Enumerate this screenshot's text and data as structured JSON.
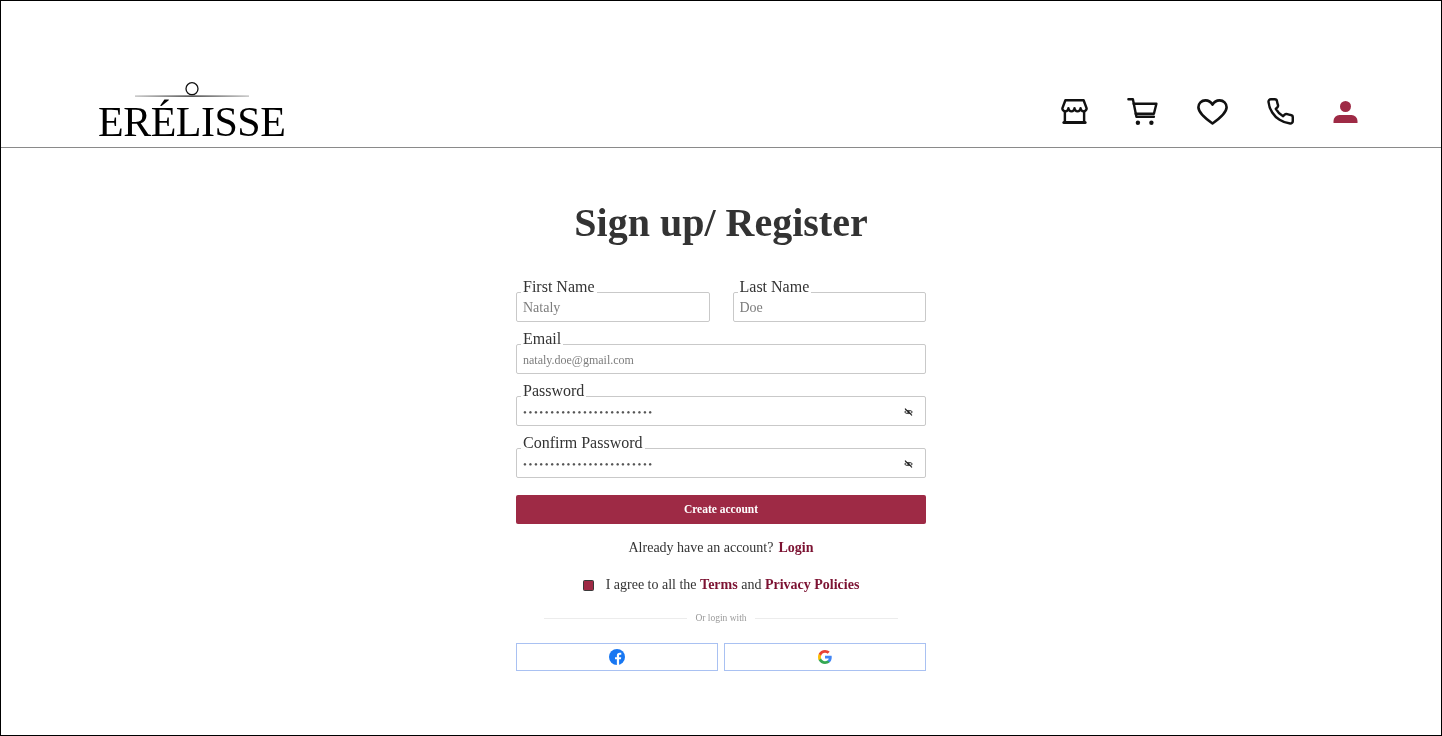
{
  "header": {
    "logo": "ERÉLISSE",
    "nav_icons": [
      {
        "kind": "store",
        "selected": false
      },
      {
        "kind": "cart",
        "selected": false
      },
      {
        "kind": "heart",
        "selected": false
      },
      {
        "kind": "phone",
        "selected": false
      },
      {
        "kind": "user",
        "selected": true
      }
    ]
  },
  "form": {
    "title": "Sign up/ Register",
    "rows": [
      [
        {
          "kind": "text",
          "label": "First Name",
          "value": "Nataly"
        },
        {
          "kind": "text",
          "label": "Last Name",
          "value": "Doe"
        }
      ],
      [
        {
          "kind": "email",
          "label": "Email",
          "value": "nataly.doe@gmail.com"
        }
      ],
      [
        {
          "kind": "password",
          "label": "Password",
          "value": "••••••••••••••••••••••••"
        }
      ],
      [
        {
          "kind": "password",
          "label": "Confirm Password",
          "value": "••••••••••••••••••••••••"
        }
      ]
    ],
    "submit": "Create account",
    "login_prompt": {
      "text": "Already have an account?",
      "link": "Login"
    },
    "agreement": {
      "checked": true,
      "parts": [
        {
          "kind": "text",
          "text": "I agree to all the"
        },
        {
          "kind": "link",
          "text": "Terms"
        },
        {
          "kind": "text",
          "text": "and"
        },
        {
          "kind": "link",
          "text": "Privacy Policies"
        }
      ]
    },
    "divider": "Or login with",
    "social": [
      {
        "kind": "facebook"
      },
      {
        "kind": "google"
      }
    ]
  }
}
